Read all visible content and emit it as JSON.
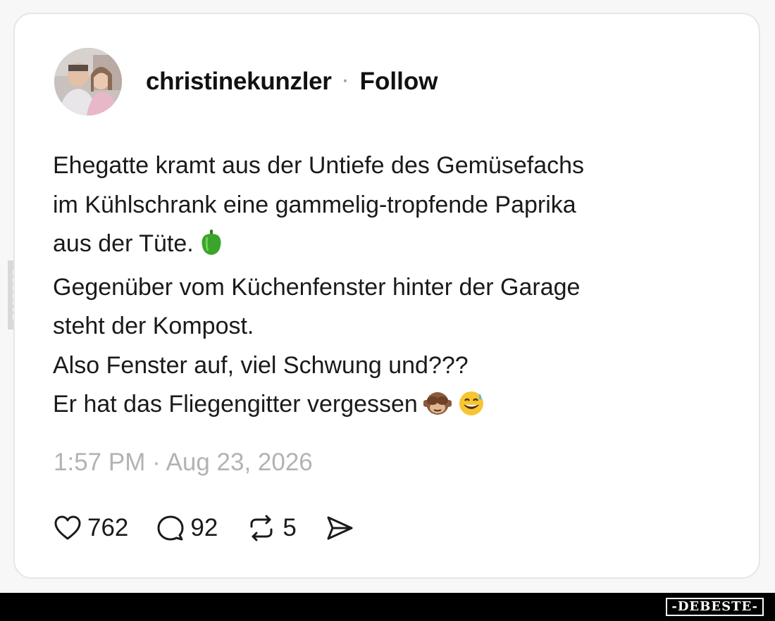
{
  "post": {
    "username": "christinekunzler",
    "separator": "·",
    "follow_label": "Follow",
    "lines": [
      "Ehegatte kramt aus der Untiefe des Gemüsefachs",
      "im Kühlschrank eine gammelig-tropfende Paprika",
      "aus der Tüte.",
      "Gegenüber vom Küchenfenster hinter der Garage",
      "steht der Kompost.",
      "Also Fenster auf, viel Schwung und???",
      "Er hat das Fliegengitter vergessen"
    ],
    "emojis": [
      "green-pepper",
      "see-no-evil-monkey",
      "grinning-sweat-face"
    ],
    "timestamp": "1:57 PM · Aug 23, 2026"
  },
  "actions": {
    "likes": "762",
    "replies": "92",
    "reposts": "5",
    "share_icon": "send-icon"
  },
  "watermark": {
    "side": "DEBESTE",
    "footer": "-DEBESTE-"
  },
  "colors": {
    "text": "#1a1a1a",
    "muted": "#b3b3b3",
    "card_border": "#e6e6e6",
    "footer_bg": "#000000"
  }
}
